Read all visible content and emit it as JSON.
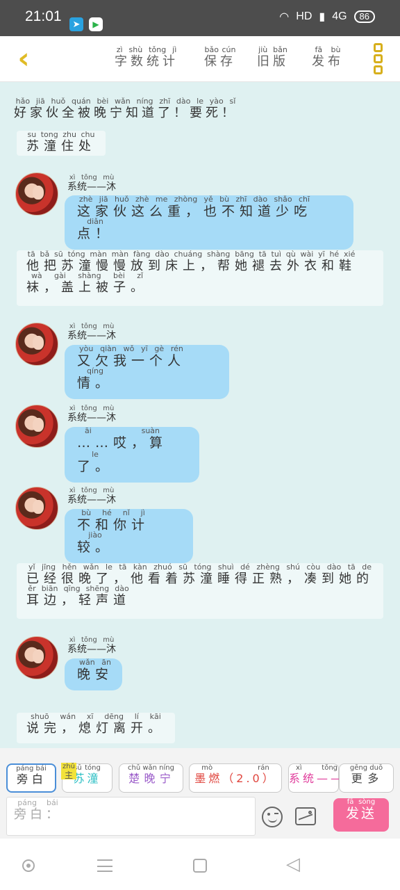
{
  "status": {
    "time": "21:01",
    "battery": "86",
    "network": "HD",
    "signal": "4G"
  },
  "toolbar": {
    "wordcount_py": "zì shù tǒng jì",
    "wordcount": "字数统计",
    "save_py": "bǎo cún",
    "save": "保存",
    "old_py": "jiù bǎn",
    "old": "旧版",
    "publish_py": "fā bù",
    "publish": "发布"
  },
  "chat": {
    "n1": "好家伙全被晚宁知道了！要死！",
    "n1_py": "hǎo jiā huǒ quán bèi wǎn níng zhī dào le yào sǐ",
    "n2": "苏潼住处",
    "n2_py": "su tong zhu chu",
    "sender": "系统——沐",
    "sender_py": "xì tǒng mù",
    "b1": "这家伙这么重，也不知道少吃点！",
    "b1_py": "zhè jiā huǒ zhè me zhòng yě bù zhī dào shǎo chī diǎn",
    "n3a": "他把苏潼慢慢放到床上，帮她褪去外衣和鞋",
    "n3a_py": "tā bǎ sū tóng màn màn fàng dào chuáng shàng bāng tā tuì qù wài yī hé xié",
    "n3b": "袜，盖上被子。",
    "n3b_py": "wà gài shàng bèi zǐ",
    "b2": "又欠我一个人情。",
    "b2_py": "yòu qiàn wǒ yī gè rén qíng",
    "b3": "……哎，算了。",
    "b3_py": "āi suàn le",
    "b4": "不和你计较。",
    "b4_py": "bù hé nǐ jì jiào",
    "n4a": "已经很晚了，他看着苏潼睡得正熟，凑到她的",
    "n4a_py": "yǐ jīng hěn wǎn le tā kàn zhuó sū tóng shuì dé zhèng shú còu dào tā de",
    "n4b": "耳边，轻声道",
    "n4b_py": "ěr biān qīng shēng dào",
    "b5": "晚安",
    "b5_py": "wǎn ān",
    "n5": "说完，熄灯离开。",
    "n5_py": "shuō wán xī dēng lí kāi"
  },
  "bottom": {
    "c1": "旁白",
    "c1_py": "páng bái",
    "c2_tag": "主",
    "c2_tag_py": "zhǔ",
    "c2": "苏潼",
    "c2_py": "sū tóng",
    "c3": "楚晚宁",
    "c3_py": "chǔ wǎn níng",
    "c4": "墨燃（2.0）",
    "c4_py": "mò rán",
    "c5": "系统——",
    "c5_py": "xì tǒng",
    "c6": "更多",
    "c6_py": "gēng duō",
    "input": "旁白：",
    "input_py": "páng bái",
    "send": "发送",
    "send_py": "fā sòng"
  },
  "colors": {
    "accent": "#e0bb25",
    "bubble": "#a6dbf7",
    "send": "#f56b9b",
    "bg": "#dff1f1"
  }
}
